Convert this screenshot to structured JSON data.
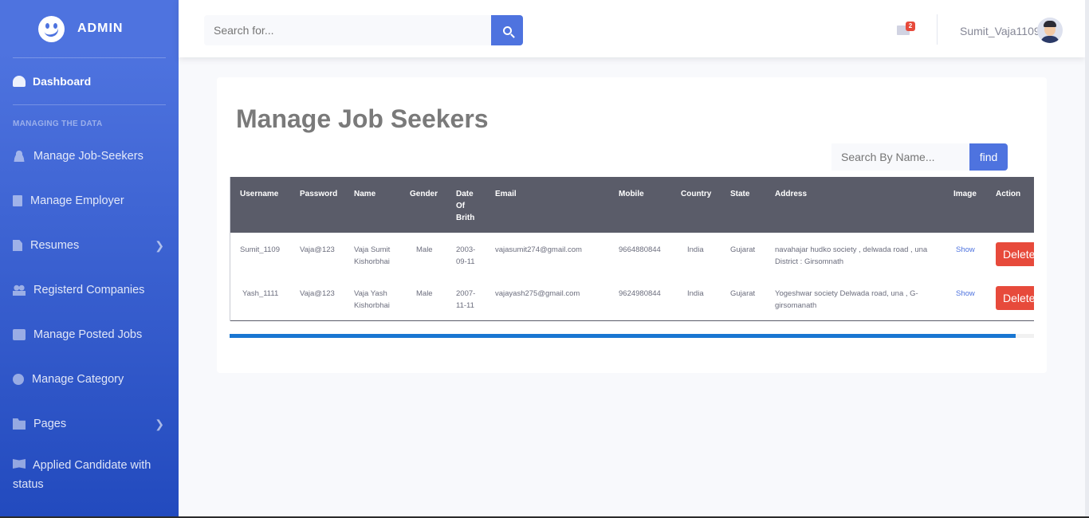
{
  "sidebar": {
    "brand": "ADMIN",
    "dashboard": "Dashboard",
    "heading": "MANAGING THE DATA",
    "items": [
      {
        "label": "Manage Job-Seekers",
        "icon": "user-icon"
      },
      {
        "label": "Manage Employer",
        "icon": "building-icon"
      },
      {
        "label": "Resumes",
        "icon": "file-icon"
      },
      {
        "label": "Registerd Companies",
        "icon": "users-icon"
      },
      {
        "label": "Manage Posted Jobs",
        "icon": "table-icon"
      },
      {
        "label": "Manage Category",
        "icon": "circle-icon"
      },
      {
        "label": "Pages",
        "icon": "folder-icon"
      },
      {
        "label": "Applied Candidate with status",
        "icon": "book-icon"
      }
    ]
  },
  "topbar": {
    "search_placeholder": "Search for...",
    "mail_count": "2",
    "username": "Sumit_Vaja1109"
  },
  "main": {
    "title": "Manage Job Seekers",
    "name_search_placeholder": "Search By Name...",
    "find_label": "find",
    "columns": [
      "Username",
      "Password",
      "Name",
      "Gender",
      "Date Of Brith",
      "Email",
      "Mobile",
      "Country",
      "State",
      "Address",
      "Image",
      "Action"
    ],
    "rows": [
      {
        "username": "Sumit_1109",
        "password": "Vaja@123",
        "name": "Vaja Sumit Kishorbhai",
        "gender": "Male",
        "dob": "2003-09-11",
        "email": "vajasumit274@gmail.com",
        "mobile": "9664880844",
        "country": "India",
        "state": "Gujarat",
        "address": "navahajar hudko society , delwada road , una District : Girsomnath",
        "image": "Show",
        "action": "Delete"
      },
      {
        "username": "Yash_1111",
        "password": "Vaja@123",
        "name": "Vaja Yash Kishorbhai",
        "gender": "Male",
        "dob": "2007-11-11",
        "email": "vajayash275@gmail.com",
        "mobile": "9624980844",
        "country": "India",
        "state": "Gujarat",
        "address": "Yogeshwar society Delwada road, una , G-girsomanath",
        "image": "Show",
        "action": "Delete"
      }
    ]
  },
  "colors": {
    "primary": "#4e73df",
    "sidebar_dark": "#224abe",
    "table_header": "#5a5c69",
    "danger": "#e74a3b"
  }
}
